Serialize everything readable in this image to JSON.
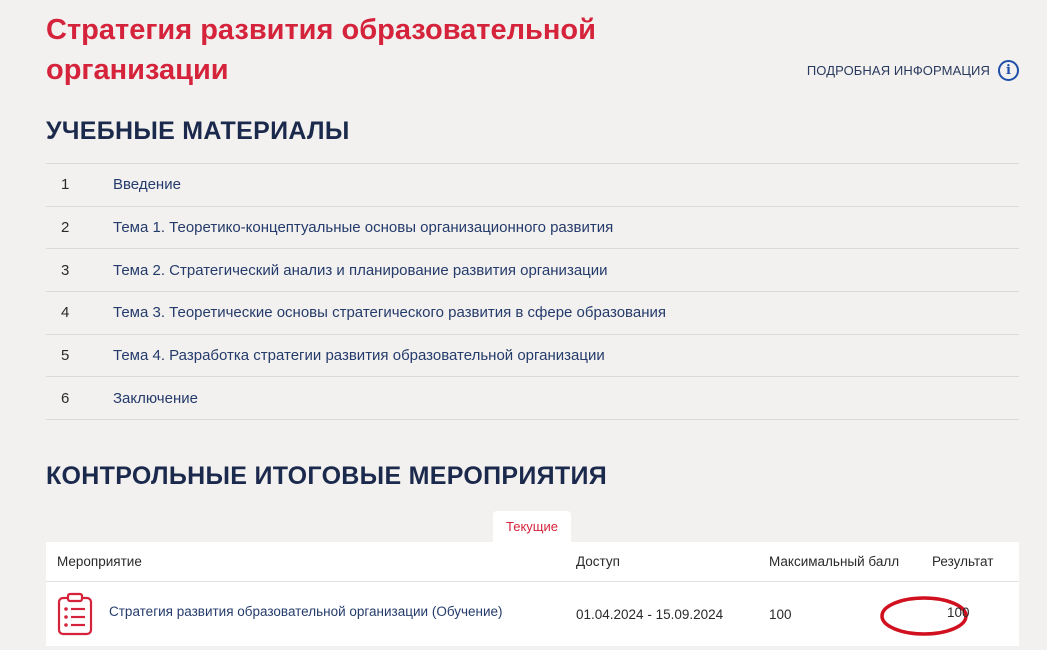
{
  "page": {
    "title": "Стратегия развития образовательной организации",
    "info_link": "ПОДРОБНАЯ ИНФОРМАЦИЯ",
    "info_icon": "info-circle-icon",
    "accent_color": "#d4233b",
    "link_color": "#243b6b"
  },
  "materials": {
    "title": "УЧЕБНЫЕ МАТЕРИАЛЫ",
    "items": [
      {
        "num": "1",
        "label": "Введение"
      },
      {
        "num": "2",
        "label": "Тема 1. Теоретико-концептуальные основы организационного развития"
      },
      {
        "num": "3",
        "label": "Тема 2. Стратегический анализ и планирование развития организации"
      },
      {
        "num": "4",
        "label": "Тема 3. Теоретические основы стратегического развития в сфере образования"
      },
      {
        "num": "5",
        "label": "Тема 4. Разработка стратегии развития образовательной организации"
      },
      {
        "num": "6",
        "label": "Заключение"
      }
    ]
  },
  "events": {
    "title": "КОНТРОЛЬНЫЕ ИТОГОВЫЕ МЕРОПРИЯТИЯ",
    "tab": "Текущие",
    "columns": [
      "Мероприятие",
      "Доступ",
      "Максимальный балл",
      "Результат"
    ],
    "rows": [
      {
        "icon": "checklist-icon",
        "name": "Стратегия развития образовательной организации (Обучение)",
        "access": "01.04.2024 - 15.09.2024",
        "max_score": "100",
        "result": "100"
      }
    ],
    "highlight_color": "#d0101e"
  }
}
